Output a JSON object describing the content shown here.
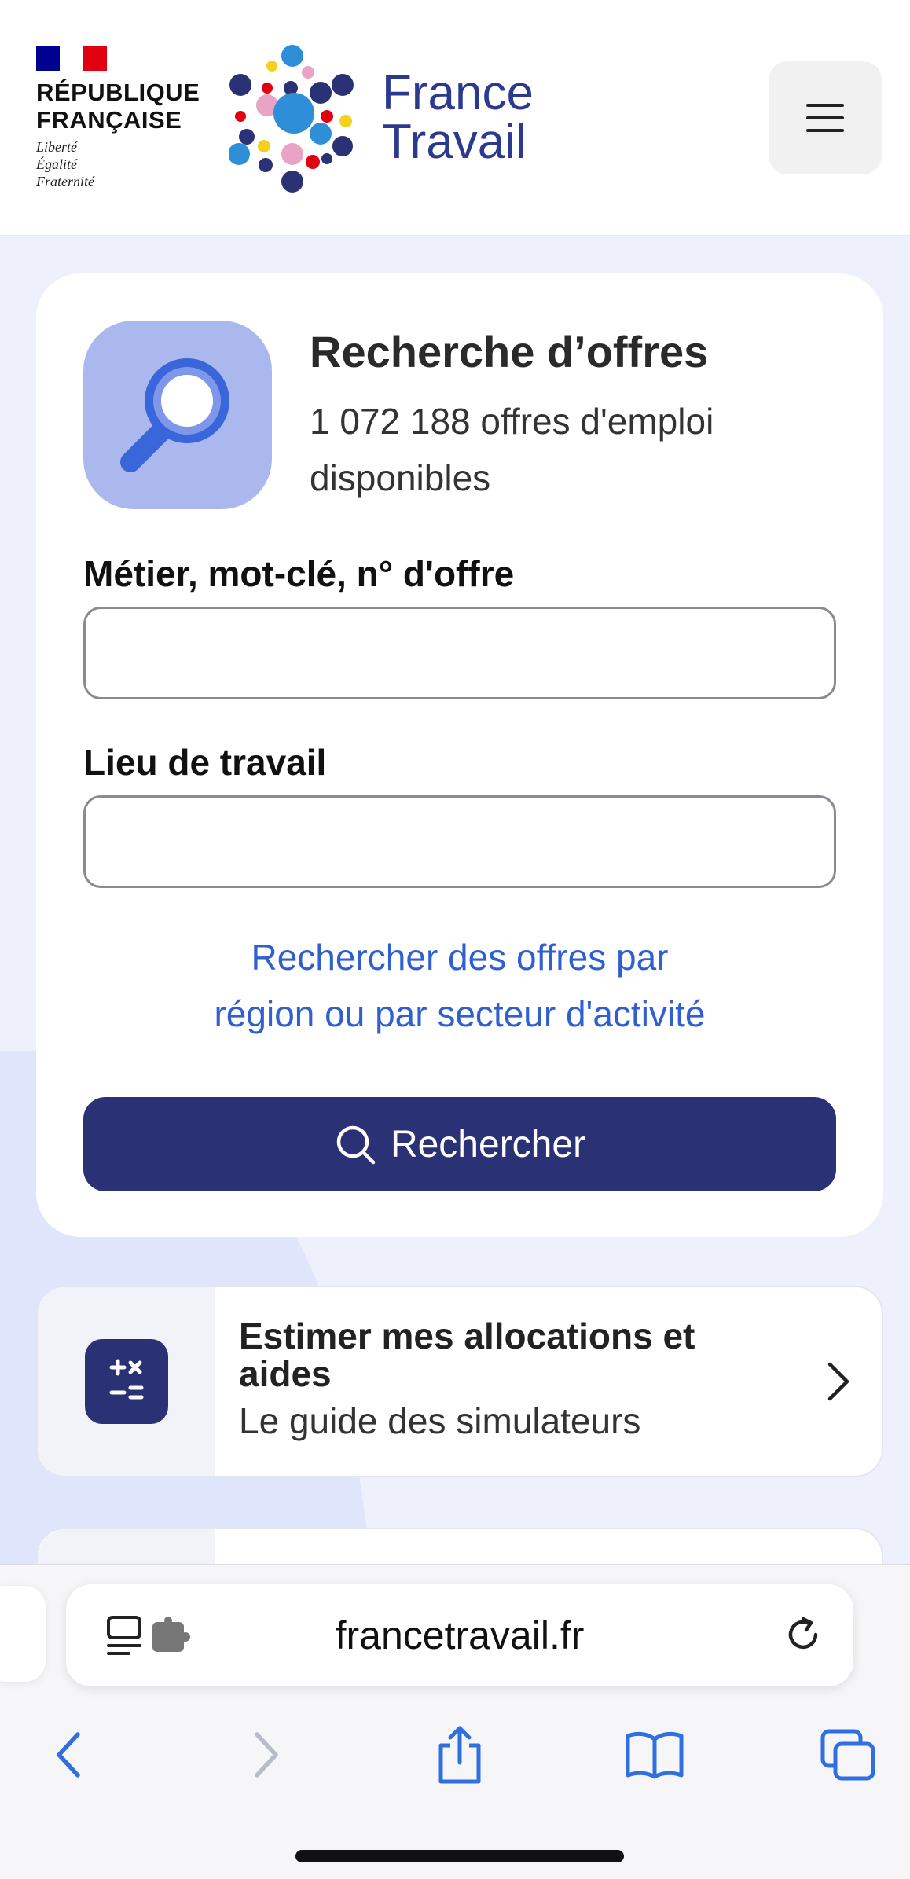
{
  "header": {
    "gov_name_line1": "RÉPUBLIQUE",
    "gov_name_line2": "FRANÇAISE",
    "motto_line1": "Liberté",
    "motto_line2": "Égalité",
    "motto_line3": "Fraternité",
    "brand_line1": "France",
    "brand_line2": "Travail",
    "menu_icon": "hamburger-icon"
  },
  "search": {
    "title": "Recherche d’offres",
    "count_text": "1 072 188 offres d'emploi disponibles",
    "keyword_label": "Métier, mot-clé, n° d'offre",
    "keyword_value": "",
    "location_label": "Lieu de travail",
    "location_value": "",
    "region_link_line1": "Rechercher des offres par",
    "region_link_line2": "région ou par secteur d'activité",
    "submit_label": "Rechercher"
  },
  "allocations": {
    "title": "Estimer mes allocations et aides",
    "subtitle": "Le guide des simulateurs"
  },
  "browser": {
    "url": "francetravail.fr"
  },
  "colors": {
    "brand_blue": "#2a3174",
    "link_blue": "#2f5fd0",
    "icon_tile": "#aab8ee",
    "background": "#eef1fb"
  }
}
